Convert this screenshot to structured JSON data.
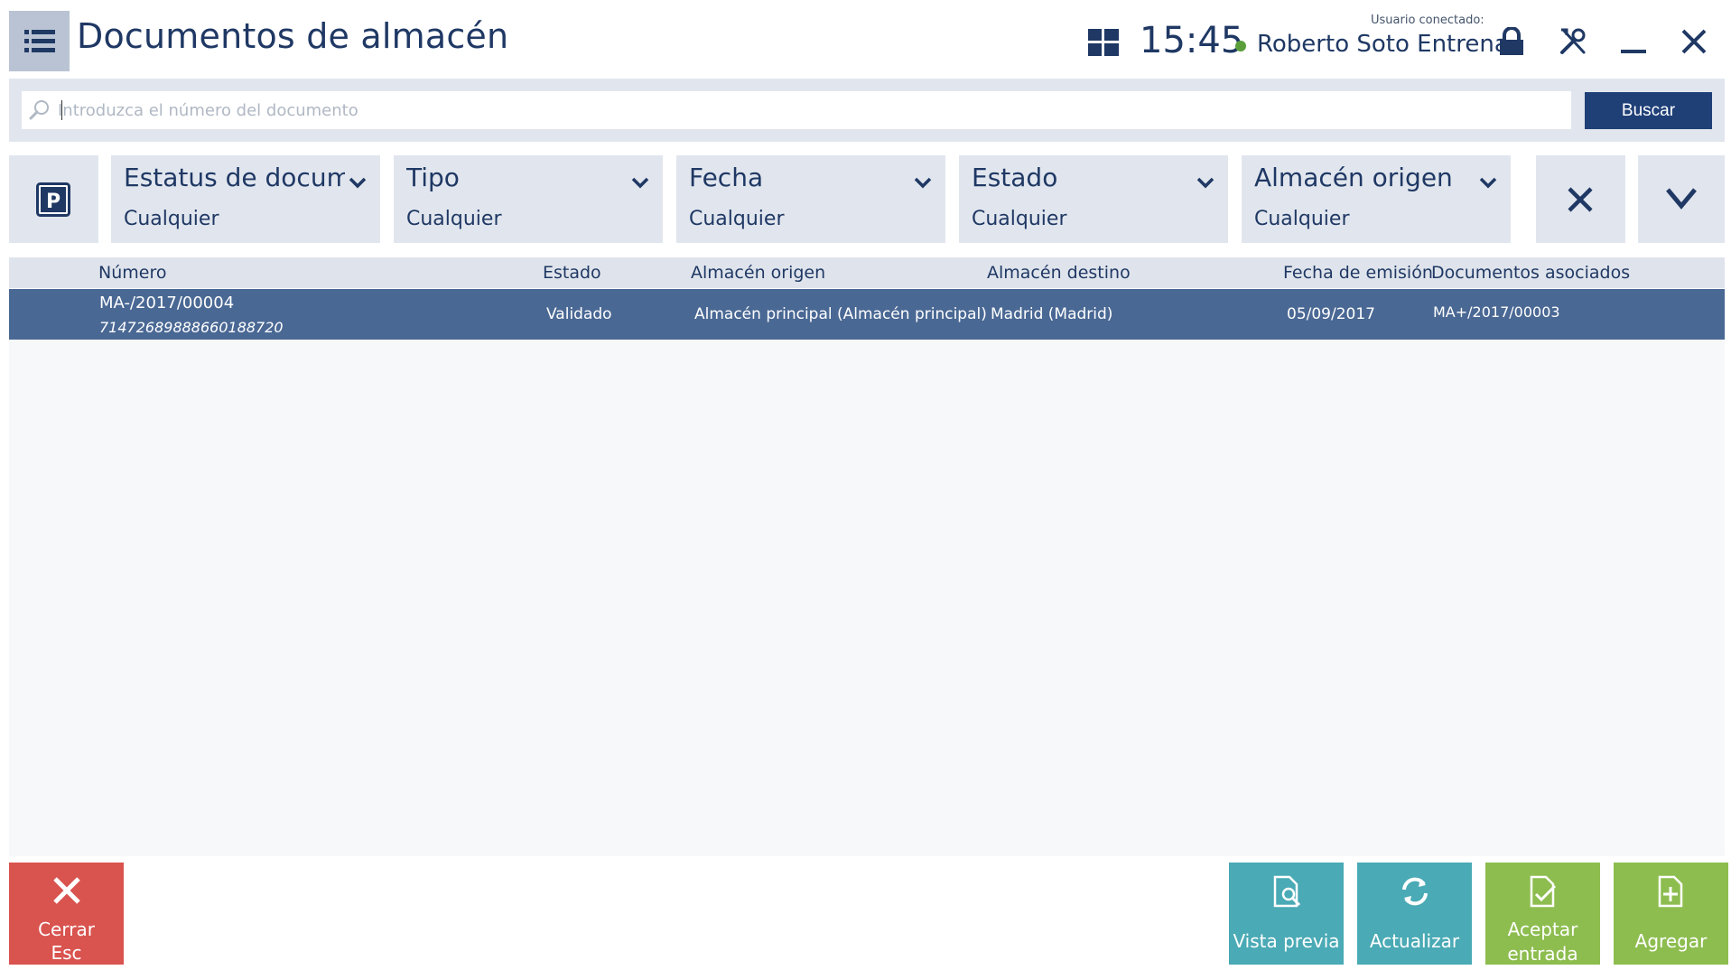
{
  "header": {
    "title": "Documentos de almacén",
    "time": "15:45",
    "user_caption": "Usuario conectado:",
    "user_name": "Roberto Soto Entrena",
    "status_color": "#5a9e3a"
  },
  "search": {
    "placeholder": "Introduzca el número del documento",
    "value": "",
    "button_label": "Buscar"
  },
  "filters": {
    "parking_icon": "P",
    "items": [
      {
        "title": "Estatus de docume",
        "value": "Cualquier"
      },
      {
        "title": "Tipo",
        "value": "Cualquier"
      },
      {
        "title": "Fecha",
        "value": "Cualquier"
      },
      {
        "title": "Estado",
        "value": "Cualquier"
      },
      {
        "title": "Almacén origen",
        "value": "Cualquier"
      }
    ]
  },
  "table": {
    "columns": [
      "Número",
      "Estado",
      "Almacén origen",
      "Almacén destino",
      "Fecha de emisión",
      "Documentos asociados"
    ],
    "rows": [
      {
        "number": "MA-/2017/00004",
        "code": "71472689888660188720",
        "status": "Validado",
        "source": "Almacén principal (Almacén principal)",
        "destination": "Madrid (Madrid)",
        "date": "05/09/2017",
        "related": "MA+/2017/00003",
        "selected": true
      }
    ]
  },
  "actions": {
    "close": {
      "label": "Cerrar",
      "shortcut": "Esc",
      "color": "#d9534f"
    },
    "preview": {
      "label": "Vista previa",
      "color": "#4aaab5"
    },
    "refresh": {
      "label": "Actualizar",
      "color": "#4aaab5"
    },
    "accept": {
      "label": "Aceptar entrada",
      "color": "#8dbd4f"
    },
    "add": {
      "label": "Agregar",
      "color": "#8dbd4f"
    }
  },
  "colors": {
    "accent_dark": "#1f3f77",
    "selected_row": "#4a6894",
    "panel": "#e1e6ee"
  }
}
